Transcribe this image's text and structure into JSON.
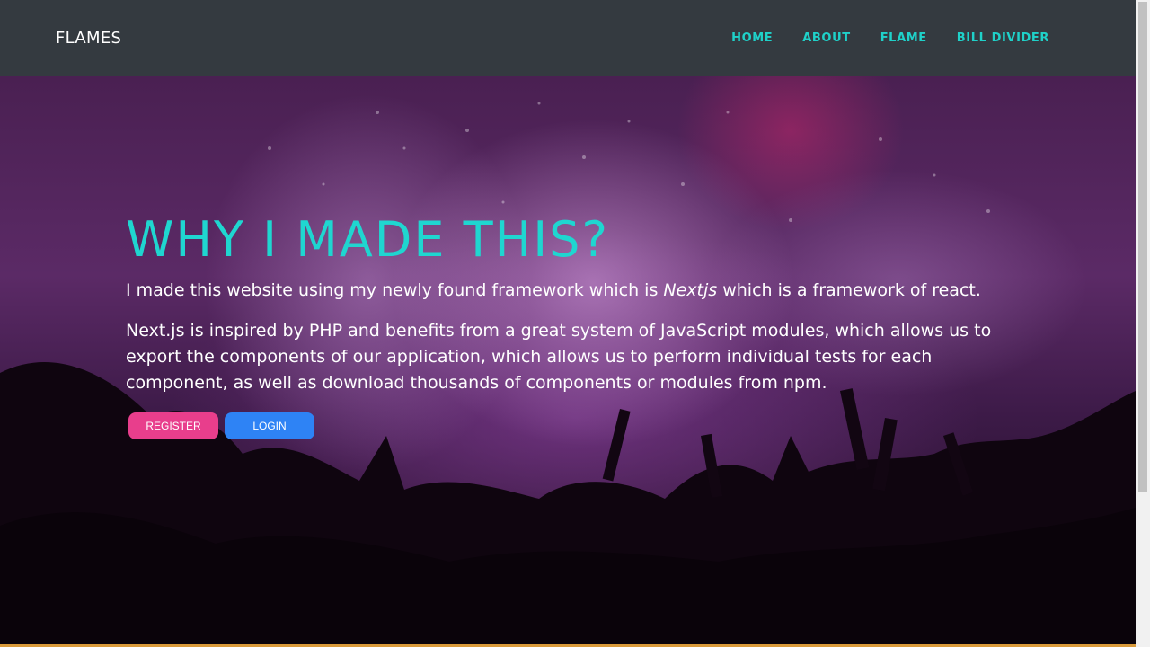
{
  "navbar": {
    "brand": "FLAMES",
    "links": [
      {
        "label": "HOME"
      },
      {
        "label": "ABOUT"
      },
      {
        "label": "FLAME"
      },
      {
        "label": "BILL DIVIDER"
      }
    ]
  },
  "hero": {
    "title": "WHY I MADE THIS?",
    "line_before": "I made this website using my newly found framework which is ",
    "line_emphasis": "Nextjs",
    "line_after": " which is a framework of react.",
    "paragraph": "Next.js is inspired by PHP and benefits from a great system of JavaScript modules, which allows us to export the components of our application, which allows us to perform individual tests for each component, as well as download thousands of components or modules from npm.",
    "register_label": "REGISTER",
    "login_label": "LOGIN"
  },
  "colors": {
    "navbar_bg": "#343a40",
    "accent": "#1fd1c9",
    "register": "#e83e8c",
    "login": "#2e83f5"
  }
}
